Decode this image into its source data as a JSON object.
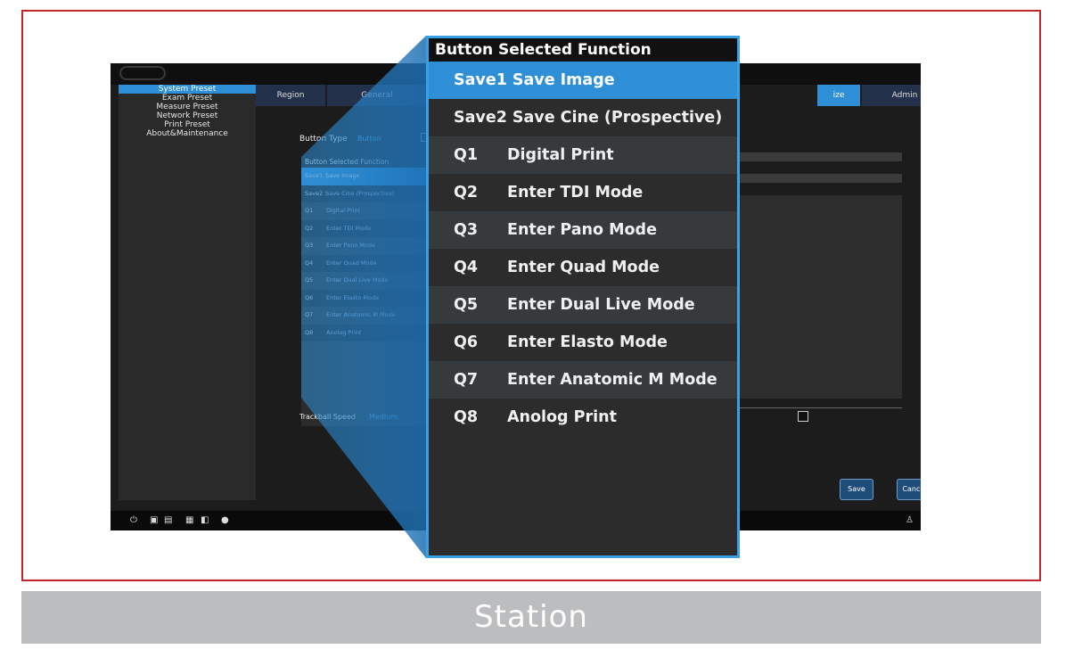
{
  "sidebar": {
    "items": [
      {
        "label": "System Preset",
        "active": true
      },
      {
        "label": "Exam Preset",
        "active": false
      },
      {
        "label": "Measure Preset",
        "active": false
      },
      {
        "label": "Network Preset",
        "active": false
      },
      {
        "label": "Print Preset",
        "active": false
      },
      {
        "label": "About&Maintenance",
        "active": false
      }
    ]
  },
  "tabs": [
    {
      "label": "Region",
      "active": false
    },
    {
      "label": "General",
      "active": false
    },
    {
      "label": "ize",
      "active": true
    },
    {
      "label": "Admin",
      "active": false
    }
  ],
  "button_type": {
    "label": "Button Type",
    "value": "Button"
  },
  "list": {
    "header": "Button   Selected Function",
    "zoom_header": "Button   Selected Function",
    "rows": [
      {
        "button": "Save1",
        "function": "Save Image",
        "selected": true
      },
      {
        "button": "Save2",
        "function": "Save Cine (Prospective)",
        "selected": false
      },
      {
        "button": "Q1",
        "function": "Digital Print",
        "selected": false
      },
      {
        "button": "Q2",
        "function": "Enter TDI Mode",
        "selected": false
      },
      {
        "button": "Q3",
        "function": "Enter Pano Mode",
        "selected": false
      },
      {
        "button": "Q4",
        "function": "Enter Quad Mode",
        "selected": false
      },
      {
        "button": "Q5",
        "function": "Enter Dual Live Mode",
        "selected": false
      },
      {
        "button": "Q6",
        "function": "Enter Elasto Mode",
        "selected": false
      },
      {
        "button": "Q7",
        "function": "Enter Anatomic M Mode",
        "selected": false
      },
      {
        "button": "Q8",
        "function": "Anolog Print",
        "selected": false
      }
    ],
    "mini_rows": [
      {
        "button": "Q1",
        "function": "Digital Print"
      },
      {
        "button": "Q2",
        "function": "Enter TDI Mode"
      },
      {
        "button": "Q3",
        "function": "Enter Pano Mode"
      },
      {
        "button": "Q4",
        "function": "Enter Quad Mode"
      },
      {
        "button": "Q5",
        "function": "Enter Dual Live Mode"
      },
      {
        "button": "Q6",
        "function": "Enter Elasto Mode"
      },
      {
        "button": "Q7",
        "function": "Enter Anatomic M Mode"
      },
      {
        "button": "Q8",
        "function": "Anolog Print"
      }
    ]
  },
  "trackball": {
    "label": "Trackball Speed",
    "value": "Medium"
  },
  "actions": {
    "save": "Save",
    "cancel": "Cancel"
  },
  "caption": "Station",
  "colors": {
    "frame": "#c0272d",
    "accent": "#2f8fd6",
    "caption_bg": "#bcbdbf"
  }
}
